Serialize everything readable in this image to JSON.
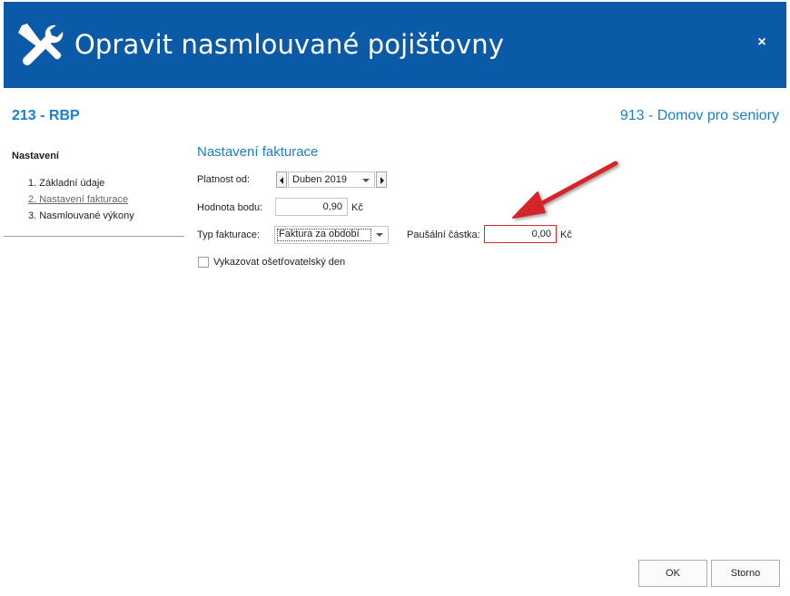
{
  "window": {
    "title": "Opravit nasmlouvané pojišťovny",
    "title_icon": "wrench-screwdriver-icon",
    "close_label": "×",
    "brand_color": "#0a5aa8",
    "accent_color": "#1a7fc8"
  },
  "header": {
    "left": "213 - RBP",
    "right": "913 - Domov pro seniory"
  },
  "nav": {
    "title": "Nastavení",
    "items": [
      {
        "label": "1. Základní údaje"
      },
      {
        "label": "2. Nastavení fakturace"
      },
      {
        "label": "3. Nasmlouvané výkony"
      }
    ]
  },
  "section": {
    "title": "Nastavení fakturace"
  },
  "form": {
    "platnost_label": "Platnost od:",
    "platnost_value": "Duben 2019",
    "hodnota_label": "Hodnota bodu:",
    "hodnota_value": "0,90",
    "currency": "Kč",
    "typ_label": "Typ fakturace:",
    "typ_value": "Faktura za období",
    "pausalni_label": "Paušální částka:",
    "pausalni_value": "0,00",
    "checkbox_label": "Vykazovat ošetřovatelský den",
    "checkbox_checked": false
  },
  "buttons": {
    "ok": "OK",
    "cancel": "Storno"
  },
  "annotation": {
    "arrow_color": "#d4282b"
  }
}
